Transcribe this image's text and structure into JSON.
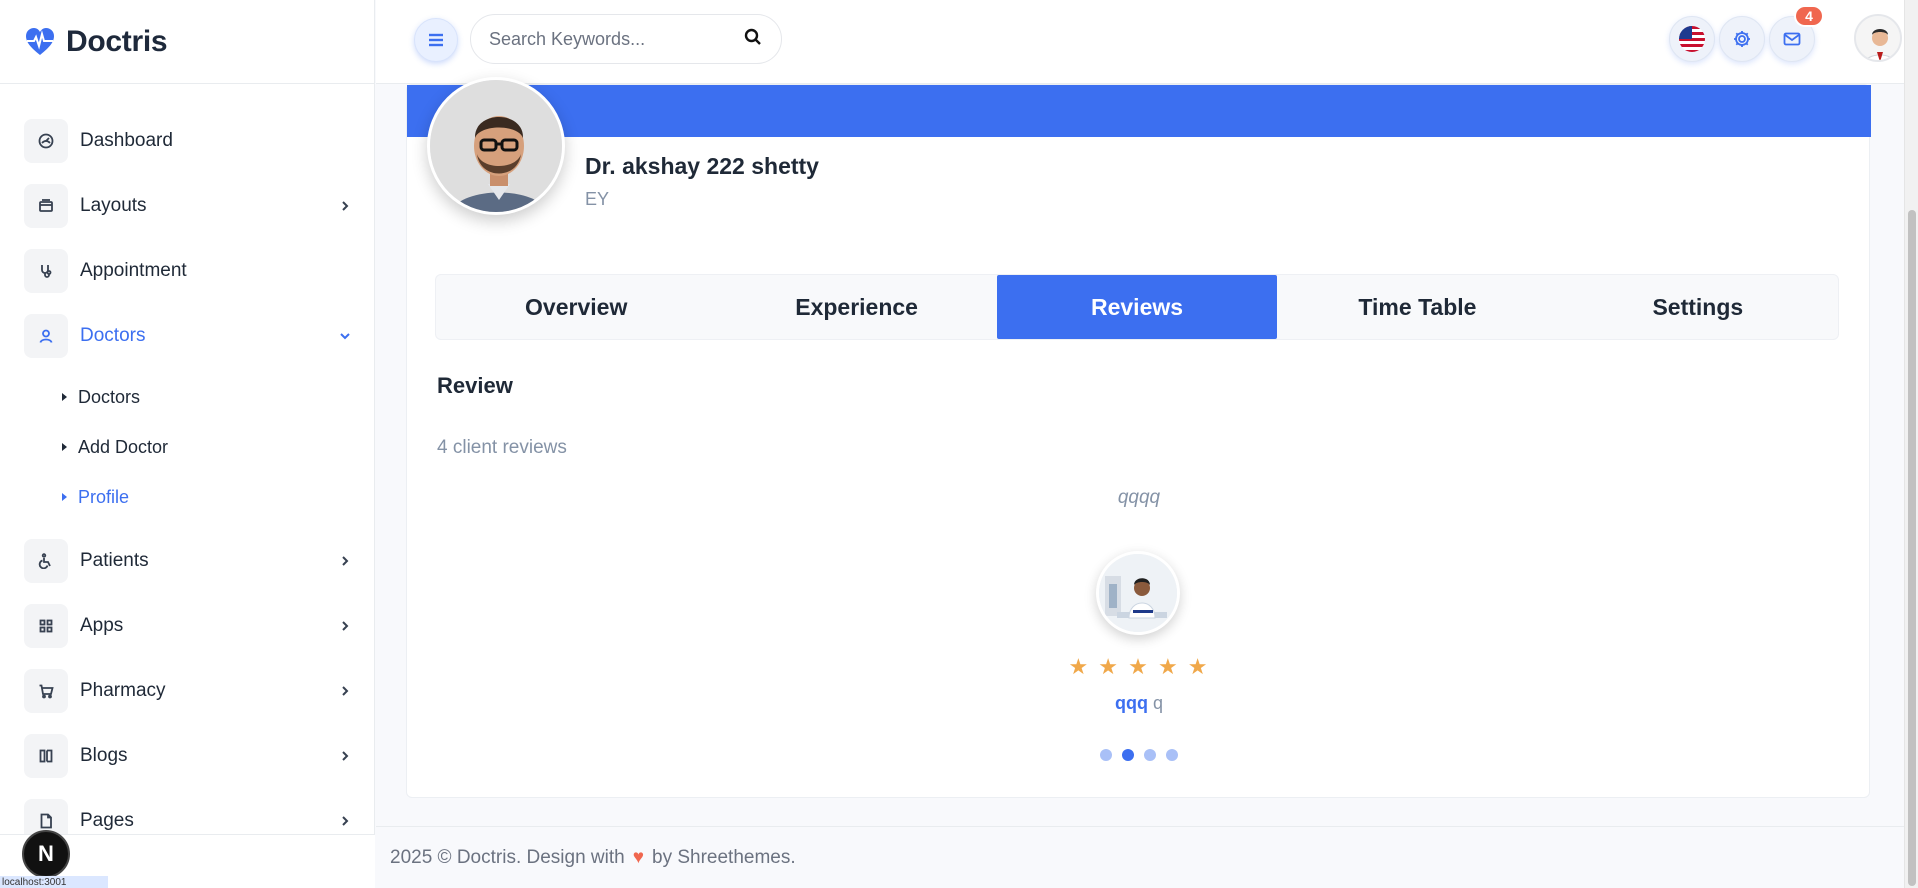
{
  "brand": {
    "name": "Doctris",
    "accent": "#3c6ff0"
  },
  "sidebar": {
    "items": [
      {
        "label": "Dashboard",
        "icon": "dashboard-icon"
      },
      {
        "label": "Layouts",
        "icon": "layout-icon"
      },
      {
        "label": "Appointment",
        "icon": "stethoscope-icon"
      },
      {
        "label": "Doctors",
        "icon": "user-icon",
        "expanded": true,
        "children": [
          "Doctors",
          "Add Doctor",
          "Profile"
        ],
        "active_child": "Profile"
      },
      {
        "label": "Patients",
        "icon": "wheelchair-icon"
      },
      {
        "label": "Apps",
        "icon": "apps-grid-icon"
      },
      {
        "label": "Pharmacy",
        "icon": "cart-icon"
      },
      {
        "label": "Blogs",
        "icon": "book-icon"
      },
      {
        "label": "Pages",
        "icon": "file-icon"
      }
    ],
    "bottom_badge": "N",
    "bottom_tag": "localhost:3001"
  },
  "topbar": {
    "search_placeholder": "Search Keywords...",
    "mail_badge": "4"
  },
  "profile": {
    "name": "Dr. akshay 222 shetty",
    "subtitle": "EY"
  },
  "tabs": [
    "Overview",
    "Experience",
    "Reviews",
    "Time Table",
    "Settings"
  ],
  "active_tab": "Reviews",
  "reviews": {
    "title": "Review",
    "count_text": "4 client reviews",
    "current": {
      "text": "qqqq",
      "rating": 5,
      "stars": "★ ★ ★ ★ ★",
      "name": "qqq",
      "role": "q"
    },
    "slides": 4,
    "active_slide": 2
  },
  "footer": {
    "prefix": "2025 © Doctris. Design with",
    "suffix": "by Shreethemes."
  },
  "colors": {
    "primary": "#3c6ff0",
    "star": "#f0a84a",
    "badge": "#f0674f",
    "muted": "#8492a6"
  }
}
